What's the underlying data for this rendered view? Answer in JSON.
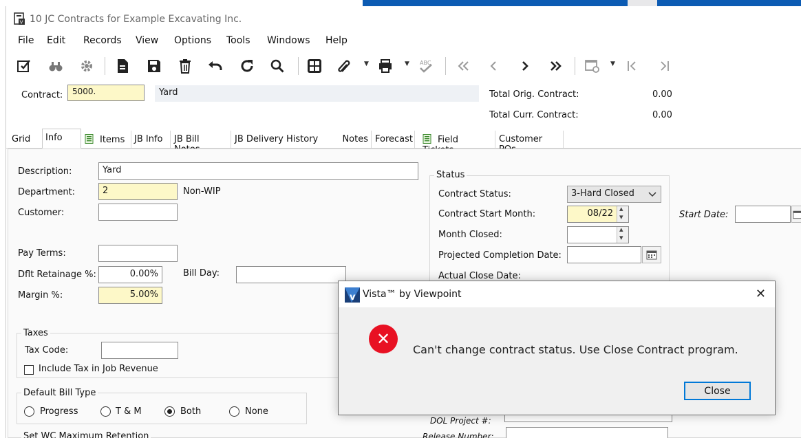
{
  "window": {
    "title": "10 JC Contracts for Example Excavating Inc."
  },
  "menu": [
    "File",
    "Edit",
    "Records",
    "View",
    "Options",
    "Tools",
    "Windows",
    "Help"
  ],
  "toolbar": {
    "icons": [
      "edit-icon",
      "find-icon",
      "settings-icon",
      "new-record-icon",
      "save-icon",
      "delete-icon",
      "undo-icon",
      "refresh-icon",
      "search-icon",
      "grid-icon",
      "attach-icon",
      "print-icon",
      "spellcheck-icon",
      "first-record-icon",
      "previous-record-icon",
      "next-record-icon",
      "last-record-icon",
      "view-icon",
      "first-page-icon",
      "last-page-icon"
    ]
  },
  "header": {
    "contract_label": "Contract:",
    "contract_value": "5000.",
    "contract_desc": "Yard",
    "total_orig_label": "Total Orig. Contract:",
    "total_orig_value": "0.00",
    "total_curr_label": "Total Curr. Contract:",
    "total_curr_value": "0.00"
  },
  "tabs": [
    {
      "label": "Grid"
    },
    {
      "label": "Info",
      "active": true
    },
    {
      "label": "Items"
    },
    {
      "label": "JB Info"
    },
    {
      "label": "JB Bill Notes"
    },
    {
      "label": "JB Delivery History"
    },
    {
      "label": "Notes"
    },
    {
      "label": "Forecast"
    },
    {
      "label": "Field Tickets"
    },
    {
      "label": "Customer POs"
    }
  ],
  "info": {
    "description_label": "Description:",
    "description_value": "Yard",
    "department_label": "Department:",
    "department_value": "2",
    "department_desc": "Non-WIP",
    "customer_label": "Customer:",
    "customer_value": "",
    "pay_terms_label": "Pay Terms:",
    "pay_terms_value": "",
    "dflt_retainage_label": "Dflt Retainage %:",
    "dflt_retainage_value": "0.00%",
    "bill_day_label": "Bill Day:",
    "bill_day_value": "",
    "margin_label": "Margin %:",
    "margin_value": "5.00%",
    "taxes_title": "Taxes",
    "tax_code_label": "Tax Code:",
    "tax_code_value": "",
    "include_tax_label": "Include Tax in Job Revenue",
    "include_tax_checked": false,
    "bill_type_title": "Default Bill Type",
    "bill_type_options": [
      "Progress",
      "T & M",
      "Both",
      "None"
    ],
    "bill_type_selected": "Both",
    "wc_title": "Set WC Maximum Retention"
  },
  "status": {
    "title": "Status",
    "contract_status_label": "Contract Status:",
    "contract_status_value": "3-Hard Closed",
    "start_month_label": "Contract Start Month:",
    "start_month_value": "08/22",
    "month_closed_label": "Month Closed:",
    "month_closed_value": "",
    "projected_label": "Projected Completion Date:",
    "projected_value": "",
    "actual_close_label": "Actual Close Date:",
    "start_date_label": "Start Date:",
    "start_date_value": "",
    "dol_project_label": "DOL Project #:",
    "release_number_label": "Release Number:"
  },
  "dialog": {
    "title": "Vista™ by Viewpoint",
    "message": "Can't change contract status. Use Close Contract program.",
    "close_button": "Close"
  },
  "colors": {
    "required_field_bg": "#fdf8c8",
    "error_red": "#e81123",
    "focus_blue": "#0078d7",
    "taskbar_blue": "#0c5bb3"
  }
}
